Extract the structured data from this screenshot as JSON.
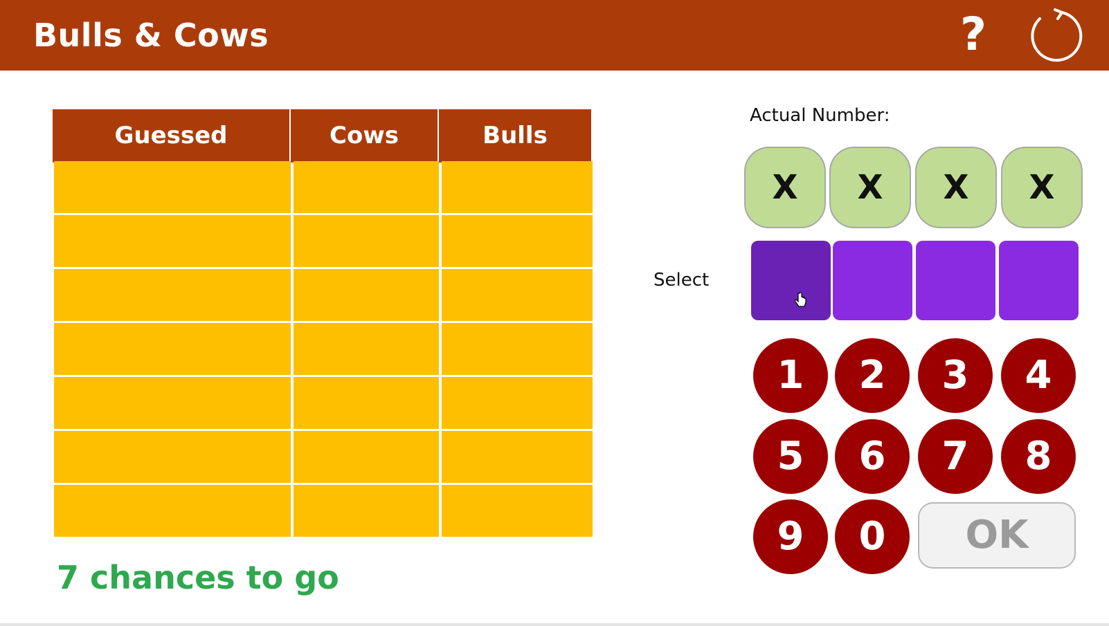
{
  "header": {
    "title": "Bulls & Cows",
    "help_label": "?",
    "icons": {
      "restart": "restart-icon"
    }
  },
  "table": {
    "columns": [
      "Guessed",
      "Cows",
      "Bulls"
    ],
    "rows": [
      [
        "",
        "",
        ""
      ],
      [
        "",
        "",
        ""
      ],
      [
        "",
        "",
        ""
      ],
      [
        "",
        "",
        ""
      ],
      [
        "",
        "",
        ""
      ],
      [
        "",
        "",
        ""
      ],
      [
        "",
        "",
        ""
      ]
    ]
  },
  "status": {
    "chances_text": "7 chances to go"
  },
  "actual": {
    "label": "Actual Number:",
    "digits": [
      "X",
      "X",
      "X",
      "X"
    ]
  },
  "select": {
    "label": "Select",
    "slots": [
      "",
      "",
      "",
      ""
    ],
    "active_index": 0
  },
  "keypad": {
    "digits": [
      "1",
      "2",
      "3",
      "4",
      "5",
      "6",
      "7",
      "8",
      "9",
      "0"
    ],
    "ok_label": "OK"
  },
  "colors": {
    "header": "#ab3c0a",
    "cell": "#fdbf00",
    "chances": "#2fa84f",
    "secret_slot": "#c0dc94",
    "guess_slot": "#8a2be2",
    "guess_slot_active": "#6a22b5",
    "digit_button": "#9c0000"
  }
}
